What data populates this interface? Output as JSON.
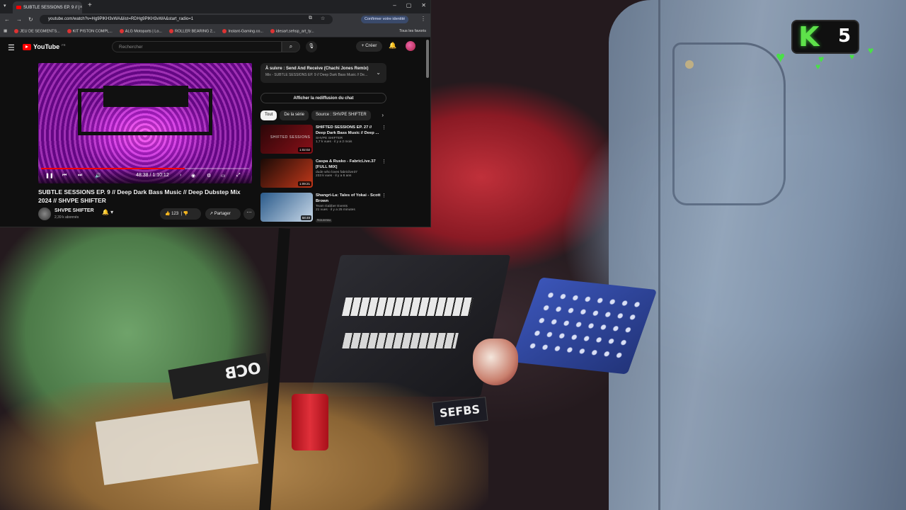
{
  "browser": {
    "tab_title": "SUBTLE SESSIONS EP. 9 // |",
    "url": "youtube.com/watch?v=Hg9PlKH3vWA&list=RDHg9PlKH3vWA&start_radio=1",
    "identity_label": "Confirmer votre identité",
    "bookmarks": [
      "JEU DE SEGMENTS...",
      "KIT PISTON COMPL...",
      "ALG Motoparts | Lo...",
      "ROLLER BEARING 2...",
      "Instant-Gaming.co...",
      "idesart.sehsp_art_ty..."
    ],
    "all_bookmarks": "Tous les favoris"
  },
  "youtube": {
    "logo": "YouTube",
    "logo_region": "FR",
    "search_placeholder": "Rechercher",
    "create_label": "Créer",
    "player": {
      "time": "48:38 / 1:10:12",
      "progress": 0.69
    },
    "video_title": "SUBTLE SESSIONS EP. 9 // Deep Dark Bass Music // Deep Dubstep Mix 2024 // SHVPE SHIFTER",
    "channel": {
      "name": "SHVPE SHIFTER",
      "subs": "2,39 k abonnés"
    },
    "likes": "123",
    "share_label": "Partager",
    "up_next": {
      "title": "À suivre : Send And Receive (Chachi Jones Remix)",
      "subtitle": "Mix - SUBTLE SESSIONS EP. 9 // Deep Dark Bass Music // De..."
    },
    "replay_label": "Afficher la rediffusion du chat",
    "chips": [
      "Tout",
      "De la série",
      "Source : SHVPE SHIFTER"
    ],
    "recommendations": [
      {
        "title": "SHIFTED SESSIONS EP. 27 // Deep Dark Bass Music // Deep ...",
        "channel": "SHVPE SHIFTER",
        "meta": "1,7 k vues · il y a 2 mois",
        "duration": "1:02:02",
        "thumb_text": "SHIFTED SESSIONS",
        "colors": [
          "#2a0608",
          "#8a1018"
        ]
      },
      {
        "title": "Caspa & Rusko - FabricLive.37 [FULL MIX]",
        "channel": "dude who loves fabriclive37",
        "meta": "233 k vues · il y a 6 ans",
        "duration": "1:09:21",
        "thumb_text": "",
        "colors": [
          "#1a0a06",
          "#c2381a"
        ]
      },
      {
        "title": "Shangri-La: Tales of Yokai - Scott Brown",
        "channel": "Team Gabber Events",
        "meta": "21 vues · il y a 25 minutes",
        "duration": "58:49",
        "badge": "Nouveau",
        "thumb_text": "",
        "colors": [
          "#2a5a8a",
          "#c8d8e8"
        ]
      }
    ]
  },
  "overlay": {
    "badge_letter": "K",
    "heart_count": "5",
    "accent": "#49e047"
  },
  "scene": {
    "ocb": "OCB",
    "sign": "SEFBS"
  }
}
